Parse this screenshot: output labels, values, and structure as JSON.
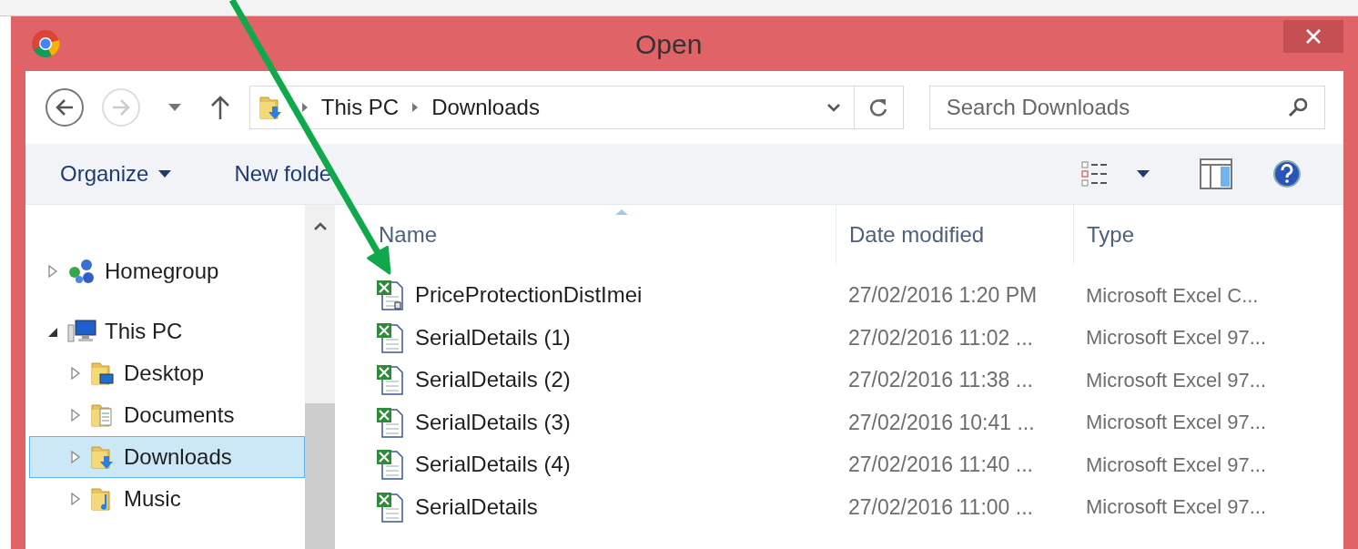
{
  "window": {
    "title": "Open"
  },
  "address": {
    "crumbs": [
      "This PC",
      "Downloads"
    ]
  },
  "search": {
    "placeholder": "Search Downloads"
  },
  "toolbar": {
    "buttons": [
      "Organize",
      "New folde"
    ]
  },
  "tree": [
    {
      "label": "Homegroup",
      "kind": "homegroup",
      "expanded": false,
      "selected": false
    },
    {
      "label": "This PC",
      "kind": "pc",
      "expanded": true,
      "selected": false,
      "children": [
        {
          "label": "Desktop",
          "kind": "desktop",
          "expanded": false,
          "selected": false
        },
        {
          "label": "Documents",
          "kind": "documents",
          "expanded": false,
          "selected": false
        },
        {
          "label": "Downloads",
          "kind": "downloads",
          "expanded": false,
          "selected": true
        },
        {
          "label": "Music",
          "kind": "music",
          "expanded": false,
          "selected": false
        }
      ]
    }
  ],
  "table": {
    "columns": [
      "Name",
      "Date modified",
      "Type"
    ],
    "rows": [
      {
        "kind": "csv",
        "name": "PriceProtectionDistImei",
        "date": "27/02/2016 1:20 PM",
        "type": "Microsoft Excel C..."
      },
      {
        "kind": "xls",
        "name": "SerialDetails (1)",
        "date": "27/02/2016 11:02 ...",
        "type": "Microsoft Excel 97..."
      },
      {
        "kind": "xls",
        "name": "SerialDetails (2)",
        "date": "27/02/2016 11:38 ...",
        "type": "Microsoft Excel 97..."
      },
      {
        "kind": "xls",
        "name": "SerialDetails (3)",
        "date": "27/02/2016 10:41 ...",
        "type": "Microsoft Excel 97..."
      },
      {
        "kind": "xls",
        "name": "SerialDetails (4)",
        "date": "27/02/2016 11:40 ...",
        "type": "Microsoft Excel 97..."
      },
      {
        "kind": "xls",
        "name": "SerialDetails",
        "date": "27/02/2016 11:00 ...",
        "type": "Microsoft Excel 97..."
      }
    ]
  }
}
